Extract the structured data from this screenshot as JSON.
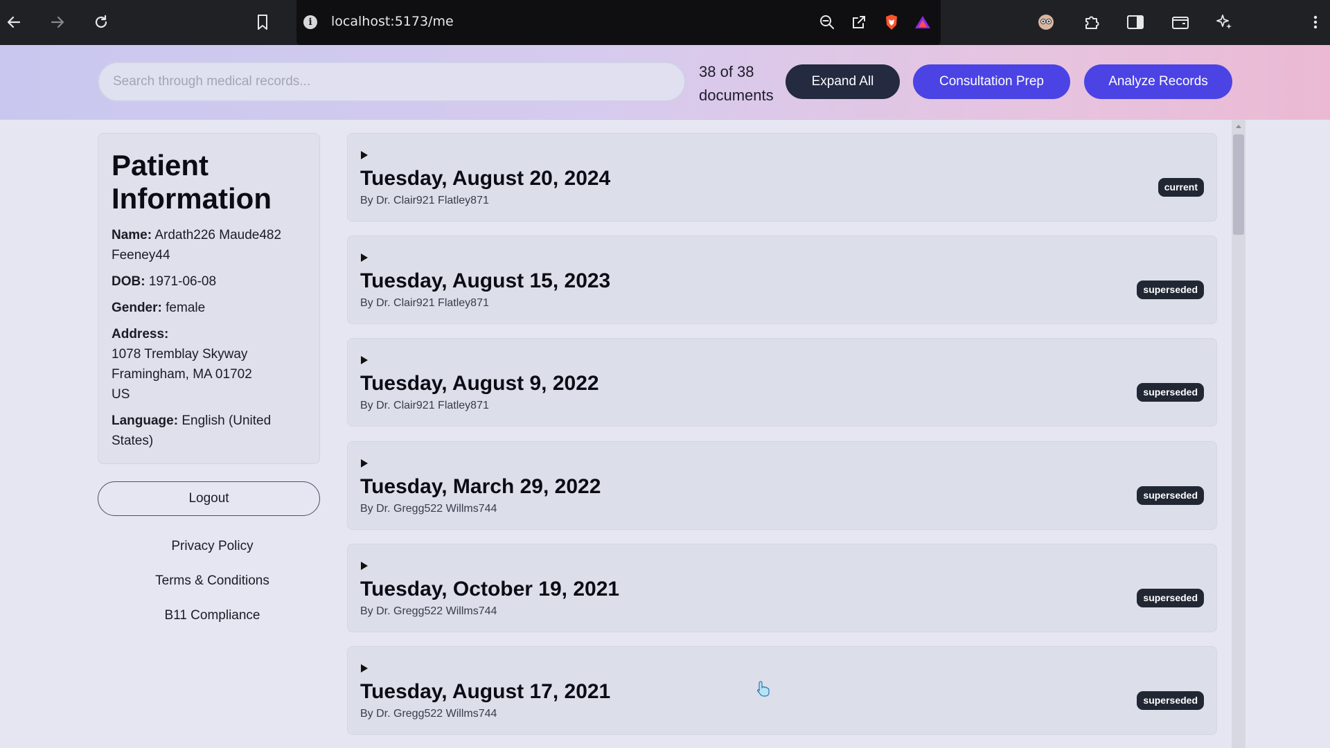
{
  "browser": {
    "url": "localhost:5173/me",
    "info_glyph": "i",
    "icons": {
      "back": "back-arrow-icon",
      "forward": "forward-arrow-icon",
      "reload": "reload-icon",
      "bookmark": "bookmark-icon",
      "zoom": "zoom-out-icon",
      "share": "share-icon",
      "brave": "brave-shield-icon",
      "rewards": "brave-rewards-icon",
      "extension_avatar": "extension-avatar-icon",
      "extensions": "puzzle-extensions-icon",
      "sidebar": "sidebar-toggle-icon",
      "wallet": "wallet-icon",
      "leo": "leo-ai-icon",
      "menu": "kebab-menu-icon"
    }
  },
  "header": {
    "search_placeholder": "Search through medical records...",
    "doc_count": "38 of 38 documents",
    "expand_all": "Expand All",
    "consultation_prep": "Consultation Prep",
    "analyze_records": "Analyze Records",
    "colors": {
      "primary": "#4b43e4",
      "dark": "#242a40"
    }
  },
  "patient": {
    "title": "Patient Information",
    "name_label": "Name:",
    "name_value": "Ardath226 Maude482 Feeney44",
    "dob_label": "DOB:",
    "dob_value": "1971-06-08",
    "gender_label": "Gender:",
    "gender_value": "female",
    "address_label": "Address:",
    "address_line1": "1078 Tremblay Skyway",
    "address_line2": "Framingham, MA 01702",
    "address_line3": "US",
    "language_label": "Language:",
    "language_value": "English (United States)"
  },
  "sidebar": {
    "logout": "Logout",
    "links": [
      "Privacy Policy",
      "Terms & Conditions",
      "B11 Compliance"
    ]
  },
  "records": [
    {
      "date": "Tuesday, August 20, 2024",
      "author": "By Dr. Clair921 Flatley871",
      "status": "current"
    },
    {
      "date": "Tuesday, August 15, 2023",
      "author": "By Dr. Clair921 Flatley871",
      "status": "superseded"
    },
    {
      "date": "Tuesday, August 9, 2022",
      "author": "By Dr. Clair921 Flatley871",
      "status": "superseded"
    },
    {
      "date": "Tuesday, March 29, 2022",
      "author": "By Dr. Gregg522 Willms744",
      "status": "superseded"
    },
    {
      "date": "Tuesday, October 19, 2021",
      "author": "By Dr. Gregg522 Willms744",
      "status": "superseded"
    },
    {
      "date": "Tuesday, August 17, 2021",
      "author": "By Dr. Gregg522 Willms744",
      "status": "superseded"
    }
  ]
}
